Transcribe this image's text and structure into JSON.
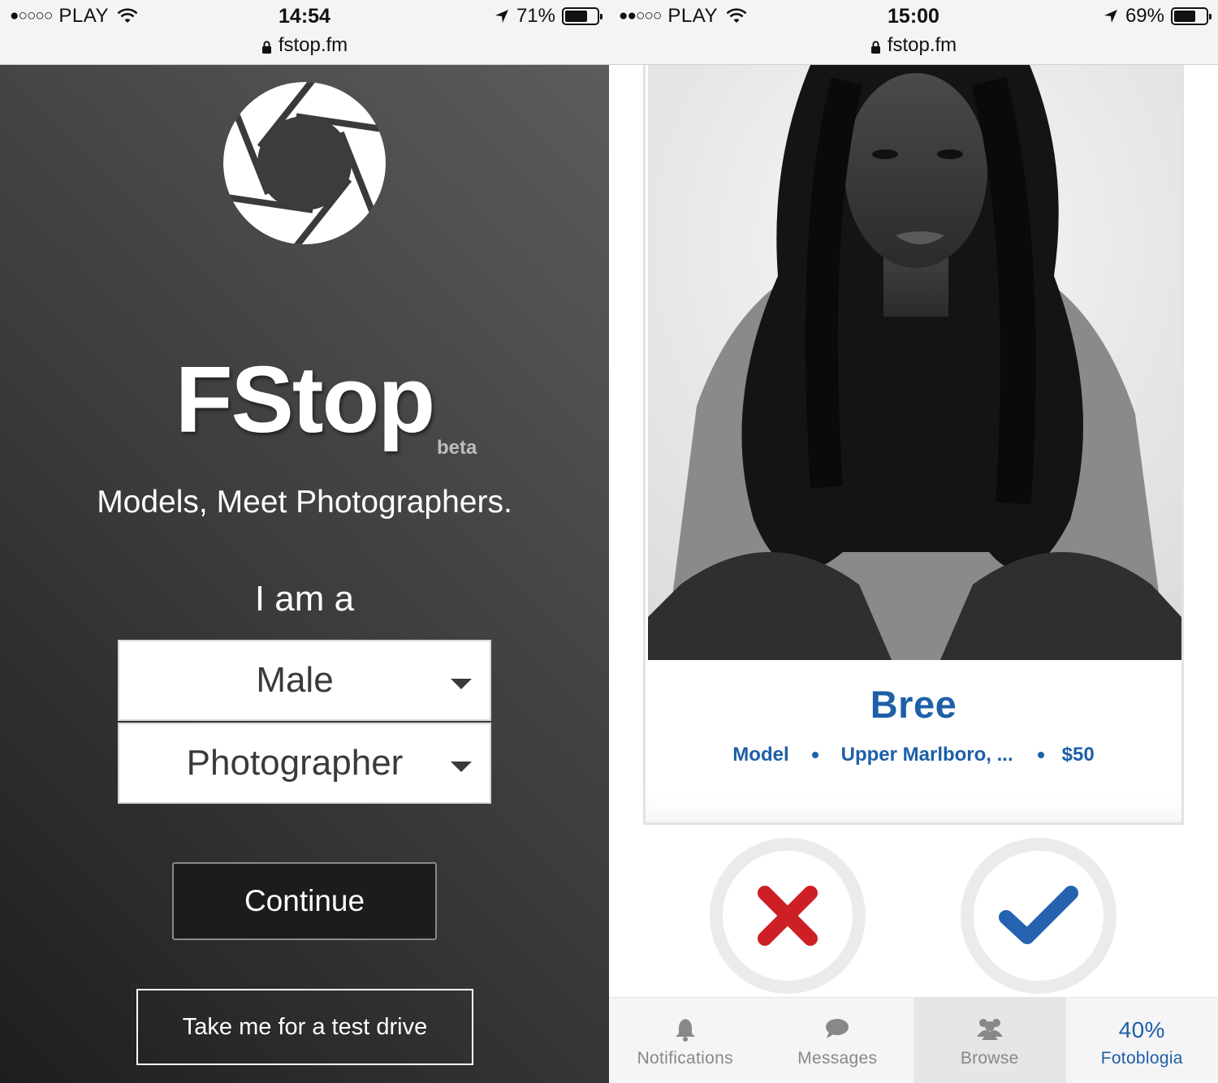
{
  "left": {
    "status": {
      "signal": "●○○○○",
      "carrier": "PLAY",
      "time": "14:54",
      "battery": "71%",
      "battery_level": 0.71,
      "url": "fstop.fm"
    },
    "brand": "FStop",
    "beta": "beta",
    "tagline": "Models, Meet Photographers.",
    "i_am_a": "I am a",
    "gender_select": {
      "value": "Male"
    },
    "role_select": {
      "value": "Photographer"
    },
    "continue_label": "Continue",
    "test_drive_label": "Take me for a test drive"
  },
  "right": {
    "status": {
      "signal": "●●○○○",
      "carrier": "PLAY",
      "time": "15:00",
      "battery": "69%",
      "battery_level": 0.69,
      "url": "fstop.fm"
    },
    "profile": {
      "name": "Bree",
      "role": "Model",
      "location": "Upper Marlboro, ...",
      "price": "$50"
    },
    "tabs": [
      {
        "label": "Notifications",
        "icon": "bell-icon"
      },
      {
        "label": "Messages",
        "icon": "speech-bubble-icon"
      },
      {
        "label": "Browse",
        "icon": "people-icon",
        "active": true
      },
      {
        "label": "Fotoblogia",
        "badge": "40%"
      }
    ]
  },
  "colors": {
    "accent_blue": "#1d5fa8",
    "reject_red": "#cc2026",
    "accept_blue": "#2563b0"
  }
}
